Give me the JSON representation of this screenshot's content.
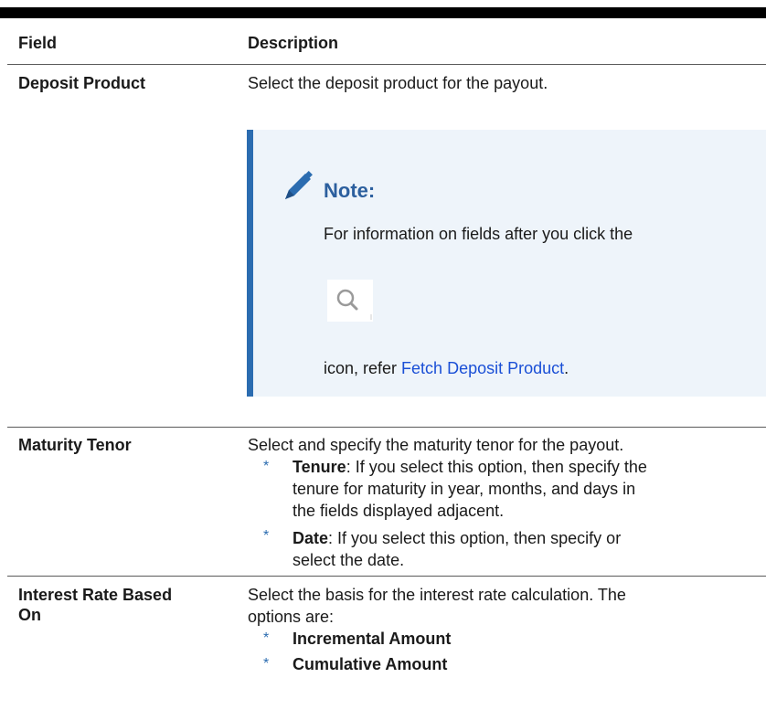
{
  "table": {
    "headers": {
      "field": "Field",
      "description": "Description"
    },
    "rows": [
      {
        "field": "Deposit Product",
        "description": "Select the deposit product for the payout.",
        "note": {
          "title": "Note:",
          "line1": "For information on fields after you click the",
          "line2_prefix": "icon, refer ",
          "link_text": "Fetch Deposit Product",
          "line2_suffix": ".",
          "icons": [
            "pencil-icon",
            "search-icon"
          ]
        }
      },
      {
        "field": "Maturity Tenor",
        "description": "Select and specify the maturity tenor for the payout.",
        "bullets": [
          {
            "term": "Tenure",
            "lines": [
              ": If you select this option, then specify the",
              "tenure for maturity in year, months, and days in",
              "the fields displayed adjacent."
            ]
          },
          {
            "term": "Date",
            "lines": [
              ": If you select this option, then specify or",
              "select the date."
            ]
          }
        ]
      },
      {
        "field_lines": [
          "Interest Rate Based",
          "On"
        ],
        "description_lines": [
          "Select the basis for the interest rate calculation. The",
          "options are:"
        ],
        "options": [
          "Incremental Amount",
          "Cumulative Amount"
        ]
      }
    ],
    "bullet_marker": "*"
  },
  "colors": {
    "note_accent": "#2b6cb0",
    "note_background": "#eef4fa",
    "link": "#1a4fd6"
  }
}
